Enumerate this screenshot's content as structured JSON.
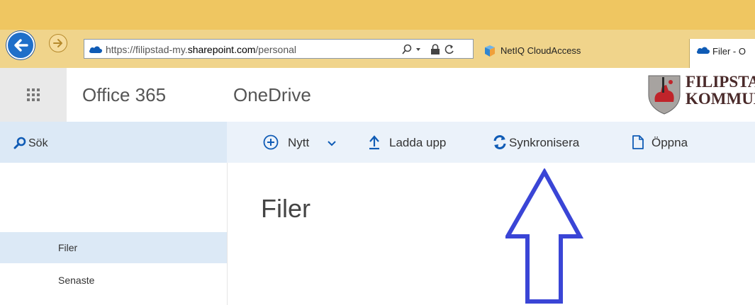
{
  "browser": {
    "url_scheme": "https://",
    "url_subdomain": "filipstad-my.",
    "url_domain": "sharepoint.com",
    "url_path": "/personal",
    "tabs": [
      {
        "label": "NetIQ CloudAccess",
        "icon": "netiq-icon"
      },
      {
        "label": "Filer - O",
        "icon": "onedrive-cloud-icon"
      }
    ]
  },
  "header": {
    "brand": "Office 365",
    "app": "OneDrive",
    "org_logo_text": "FILIPSTADS\nKOMMUN"
  },
  "search": {
    "label": "Sök"
  },
  "commands": [
    {
      "id": "new",
      "label": "Nytt",
      "icon": "plus-circle-icon"
    },
    {
      "id": "upload",
      "label": "Ladda upp",
      "icon": "upload-arrow-icon"
    },
    {
      "id": "sync",
      "label": "Synkronisera",
      "icon": "sync-icon"
    },
    {
      "id": "open",
      "label": "Öppna",
      "icon": "document-icon"
    }
  ],
  "nav": {
    "items": [
      {
        "label": "Filer",
        "selected": true
      },
      {
        "label": "Senaste",
        "selected": false
      }
    ]
  },
  "main": {
    "title": "Filer"
  },
  "colors": {
    "chrome": "#efc661",
    "command_bar": "#ebf2fa",
    "accent_blue": "#0f5bb5",
    "annotation_arrow": "#3a45d6"
  }
}
